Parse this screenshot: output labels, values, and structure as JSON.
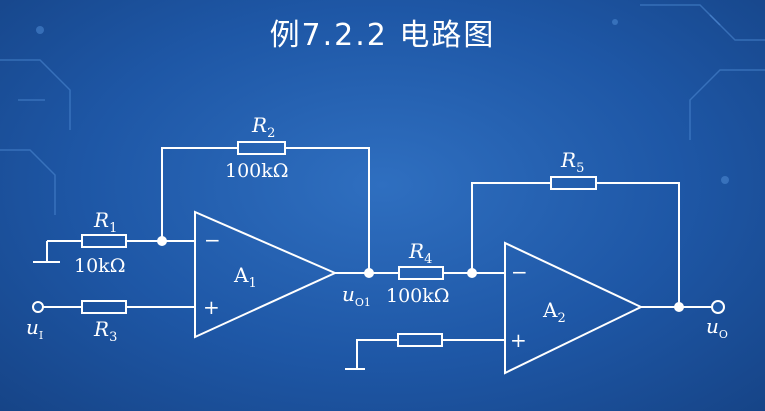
{
  "title": "例7.2.2 电路图",
  "circuit": {
    "r1": {
      "name": "R",
      "sub": "1",
      "value": "10kΩ"
    },
    "r2": {
      "name": "R",
      "sub": "2",
      "value": "100kΩ"
    },
    "r3": {
      "name": "R",
      "sub": "3"
    },
    "r4": {
      "name": "R",
      "sub": "4",
      "value": "100kΩ"
    },
    "r5": {
      "name": "R",
      "sub": "5"
    },
    "a1": {
      "name": "A",
      "sub": "1",
      "minus": "−",
      "plus": "+"
    },
    "a2": {
      "name": "A",
      "sub": "2",
      "minus": "−",
      "plus": "+"
    },
    "ui": {
      "name": "u",
      "sub": "I"
    },
    "uo1": {
      "name": "u",
      "sub": "O1"
    },
    "uo": {
      "name": "u",
      "sub": "O"
    }
  },
  "colors": {
    "background": "#1e57a6",
    "line": "#ffffff",
    "decoration": "#4f8ad4"
  }
}
